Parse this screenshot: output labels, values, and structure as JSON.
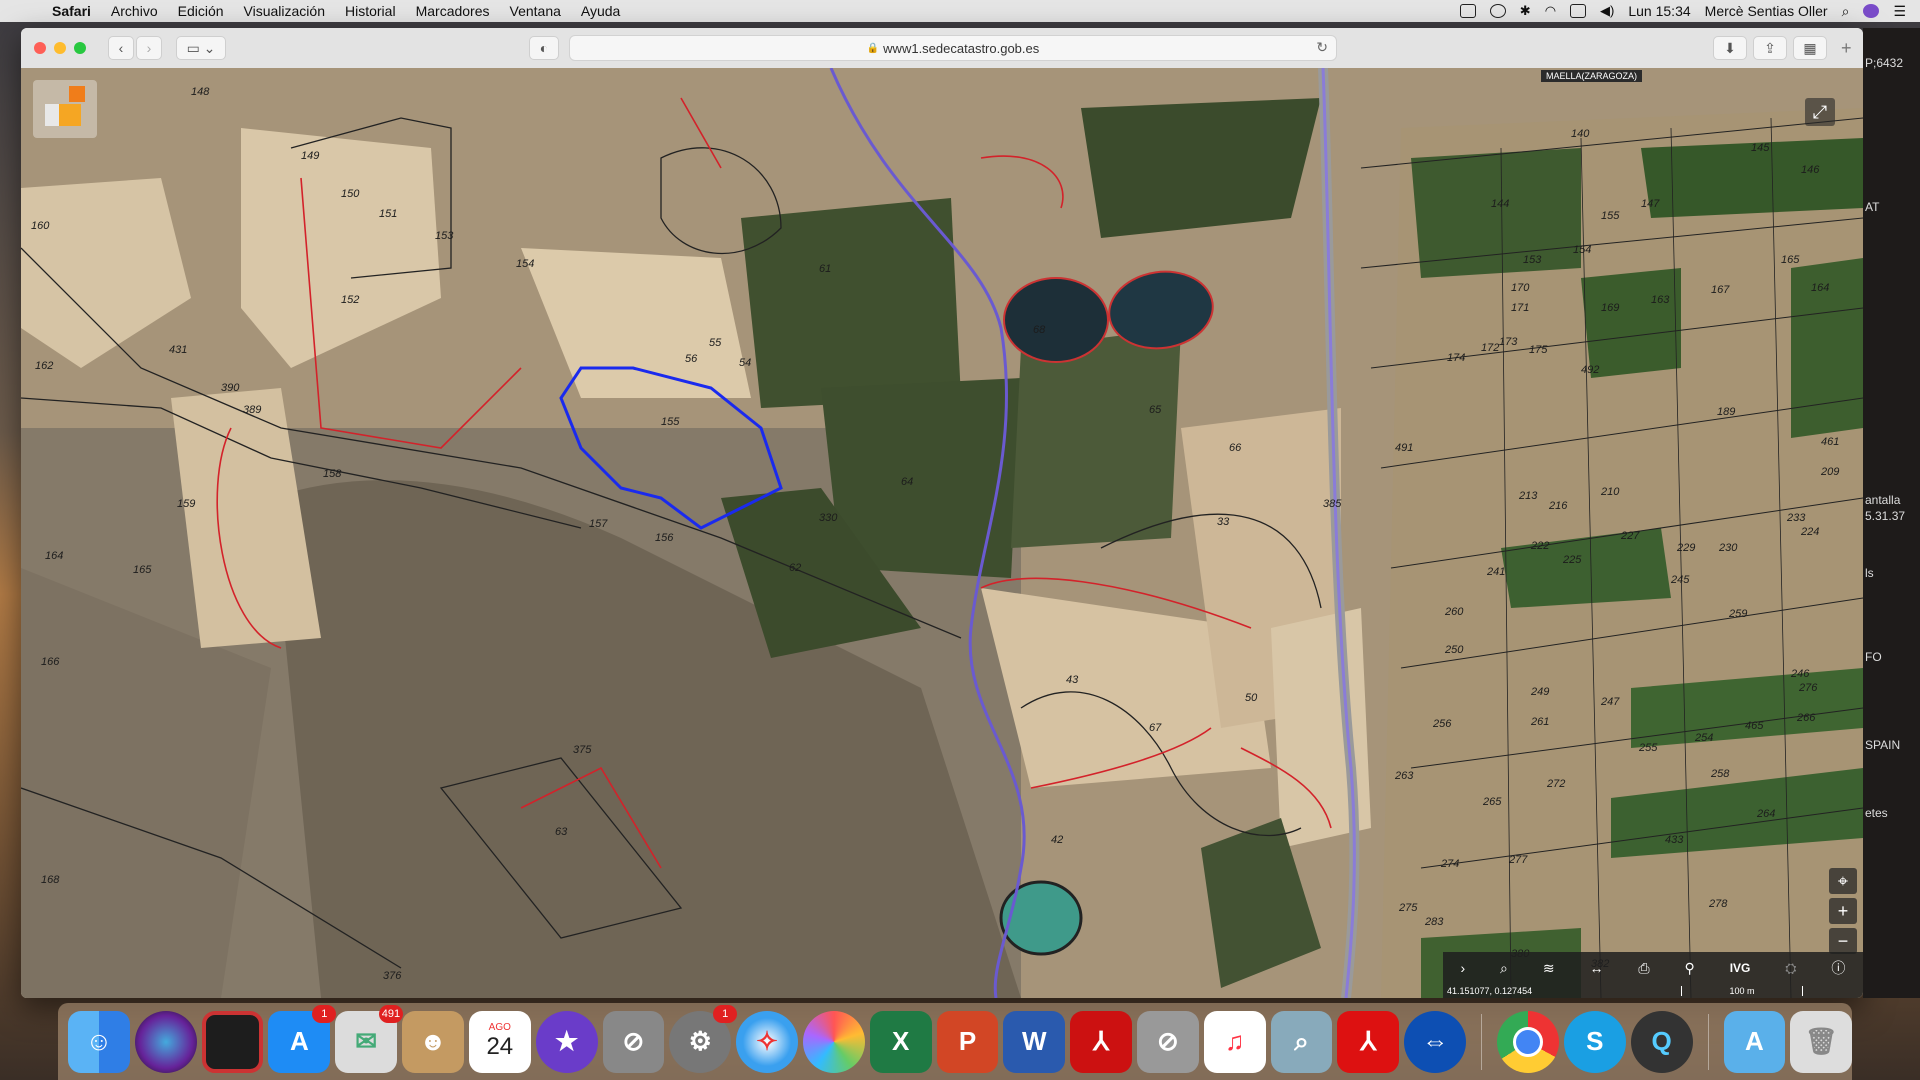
{
  "menubar": {
    "apple": "",
    "items": [
      "Safari",
      "Archivo",
      "Edición",
      "Visualización",
      "Historial",
      "Marcadores",
      "Ventana",
      "Ayuda"
    ],
    "clock": "Lun 15:34",
    "user": "Mercè Sentias Oller"
  },
  "browser": {
    "url": "www1.sedecatastro.gob.es"
  },
  "map": {
    "region_label": "MAELLA(ZARAGOZA)",
    "coordinates": "41.151077, 0.127454",
    "scale": "100 m",
    "tool_ivg": "IVG",
    "parcel_numbers": [
      {
        "t": "148"
      },
      {
        "t": "149"
      },
      {
        "t": "150"
      },
      {
        "t": "151"
      },
      {
        "t": "153"
      },
      {
        "t": "154"
      },
      {
        "t": "152"
      },
      {
        "t": "160"
      },
      {
        "t": "162"
      },
      {
        "t": "431"
      },
      {
        "t": "390"
      },
      {
        "t": "389"
      },
      {
        "t": "158"
      },
      {
        "t": "159"
      },
      {
        "t": "164"
      },
      {
        "t": "165"
      },
      {
        "t": "166"
      },
      {
        "t": "155"
      },
      {
        "t": "56"
      },
      {
        "t": "55"
      },
      {
        "t": "54"
      },
      {
        "t": "157"
      },
      {
        "t": "156"
      },
      {
        "t": "62"
      },
      {
        "t": "61"
      },
      {
        "t": "64"
      },
      {
        "t": "330"
      },
      {
        "t": "68"
      },
      {
        "t": "65"
      },
      {
        "t": "66"
      },
      {
        "t": "33"
      },
      {
        "t": "375"
      },
      {
        "t": "63"
      },
      {
        "t": "168"
      },
      {
        "t": "376"
      },
      {
        "t": "43"
      },
      {
        "t": "67"
      },
      {
        "t": "50"
      },
      {
        "t": "42"
      },
      {
        "t": "140"
      },
      {
        "t": "145"
      },
      {
        "t": "146"
      },
      {
        "t": "144"
      },
      {
        "t": "147"
      },
      {
        "t": "155"
      },
      {
        "t": "153"
      },
      {
        "t": "154"
      },
      {
        "t": "165"
      },
      {
        "t": "164"
      },
      {
        "t": "170"
      },
      {
        "t": "171"
      },
      {
        "t": "169"
      },
      {
        "t": "163"
      },
      {
        "t": "167"
      },
      {
        "t": "172"
      },
      {
        "t": "173"
      },
      {
        "t": "174"
      },
      {
        "t": "175"
      },
      {
        "t": "492"
      },
      {
        "t": "189"
      },
      {
        "t": "491"
      },
      {
        "t": "461"
      },
      {
        "t": "209"
      },
      {
        "t": "210"
      },
      {
        "t": "213"
      },
      {
        "t": "216"
      },
      {
        "t": "222"
      },
      {
        "t": "225"
      },
      {
        "t": "227"
      },
      {
        "t": "229"
      },
      {
        "t": "230"
      },
      {
        "t": "233"
      },
      {
        "t": "224"
      },
      {
        "t": "241"
      },
      {
        "t": "245"
      },
      {
        "t": "259"
      },
      {
        "t": "260"
      },
      {
        "t": "250"
      },
      {
        "t": "246"
      },
      {
        "t": "249"
      },
      {
        "t": "247"
      },
      {
        "t": "261"
      },
      {
        "t": "256"
      },
      {
        "t": "255"
      },
      {
        "t": "254"
      },
      {
        "t": "465"
      },
      {
        "t": "266"
      },
      {
        "t": "276"
      },
      {
        "t": "258"
      },
      {
        "t": "263"
      },
      {
        "t": "272"
      },
      {
        "t": "265"
      },
      {
        "t": "264"
      },
      {
        "t": "433"
      },
      {
        "t": "274"
      },
      {
        "t": "277"
      },
      {
        "t": "278"
      },
      {
        "t": "275"
      },
      {
        "t": "283"
      },
      {
        "t": "380"
      },
      {
        "t": "382"
      },
      {
        "t": "385"
      }
    ]
  },
  "sidepeek": [
    "P;6432",
    "AT",
    "antalla",
    "5.31.37",
    "ls",
    "FO",
    "SPAIN",
    "etes"
  ],
  "dock": {
    "badges": {
      "appstore": "1",
      "mail": "491",
      "prefs": "1"
    },
    "calendar_month": "AGO",
    "calendar_day": "24"
  }
}
